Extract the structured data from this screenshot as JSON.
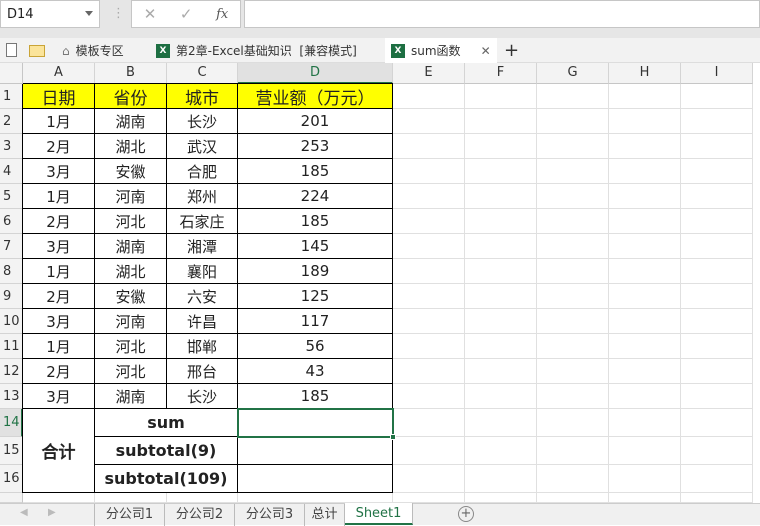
{
  "formula_bar": {
    "name_box": "D14",
    "cancel_icon": "✕",
    "enter_icon": "✓",
    "fx_label": "fx",
    "formula": ""
  },
  "file_tabs": [
    {
      "label": "模板专区",
      "icon": "home-icon"
    },
    {
      "label": "第2章-Excel基础知识  [兼容模式]",
      "icon": "excel-icon"
    },
    {
      "label": "sum函数",
      "icon": "excel-icon",
      "active": true
    }
  ],
  "columns": [
    "A",
    "B",
    "C",
    "D",
    "E",
    "F",
    "G",
    "H",
    "I"
  ],
  "rows": [
    "1",
    "2",
    "3",
    "4",
    "5",
    "6",
    "7",
    "8",
    "9",
    "10",
    "11",
    "12",
    "13",
    "14",
    "15",
    "16"
  ],
  "header": [
    "日期",
    "省份",
    "城市",
    "营业额（万元）"
  ],
  "data": [
    [
      "1月",
      "湖南",
      "长沙",
      "201"
    ],
    [
      "2月",
      "湖北",
      "武汉",
      "253"
    ],
    [
      "3月",
      "安徽",
      "合肥",
      "185"
    ],
    [
      "1月",
      "河南",
      "郑州",
      "224"
    ],
    [
      "2月",
      "河北",
      "石家庄",
      "185"
    ],
    [
      "3月",
      "湖南",
      "湘潭",
      "145"
    ],
    [
      "1月",
      "湖北",
      "襄阳",
      "189"
    ],
    [
      "2月",
      "安徽",
      "六安",
      "125"
    ],
    [
      "3月",
      "河南",
      "许昌",
      "117"
    ],
    [
      "1月",
      "河北",
      "邯郸",
      "56"
    ],
    [
      "2月",
      "河北",
      "邢台",
      "43"
    ],
    [
      "3月",
      "湖南",
      "长沙",
      "185"
    ]
  ],
  "summary": {
    "label": "合计",
    "rows": [
      "sum",
      "subtotal(9)",
      "subtotal(109)"
    ]
  },
  "sheets": [
    "分公司1",
    "分公司2",
    "分公司3",
    "总计",
    "Sheet1"
  ],
  "active_sheet": "Sheet1",
  "colors": {
    "header_fill": "#ffff00",
    "selection": "#217346"
  }
}
